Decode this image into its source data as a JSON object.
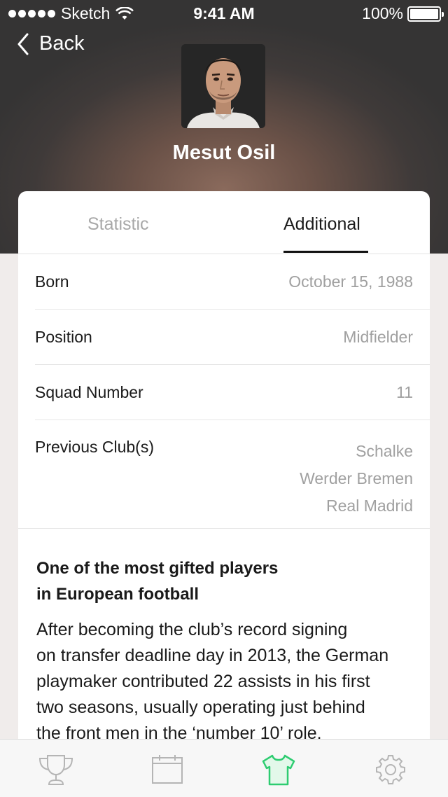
{
  "status_bar": {
    "carrier": "Sketch",
    "time": "9:41 AM",
    "battery": "100%"
  },
  "nav": {
    "back_label": "Back"
  },
  "player": {
    "name": "Mesut Osil"
  },
  "tabs": {
    "statistic": "Statistic",
    "additional": "Additional",
    "active": "additional"
  },
  "details": {
    "born_label": "Born",
    "born_value": "October 15, 1988",
    "position_label": "Position",
    "position_value": "Midfielder",
    "squad_label": "Squad Number",
    "squad_value": "11",
    "clubs_label": "Previous Club(s)",
    "clubs": [
      "Schalke",
      "Werder Bremen",
      "Real Madrid"
    ]
  },
  "article": {
    "headline_line1": "One of the most gifted players",
    "headline_line2": "in European football",
    "body_lines": [
      "After becoming the club’s record signing",
      "on transfer deadline day in 2013, the German",
      "playmaker contributed 22 assists in his first",
      "two seasons, usually operating just behind",
      "the front men in the ‘number 10’ role."
    ]
  },
  "tab_bar": {
    "items": [
      "trophy-icon",
      "calendar-icon",
      "shirt-icon",
      "gear-icon"
    ],
    "active": "shirt-icon",
    "active_color": "#2ecc71",
    "inactive_color": "#b5b5b5"
  }
}
